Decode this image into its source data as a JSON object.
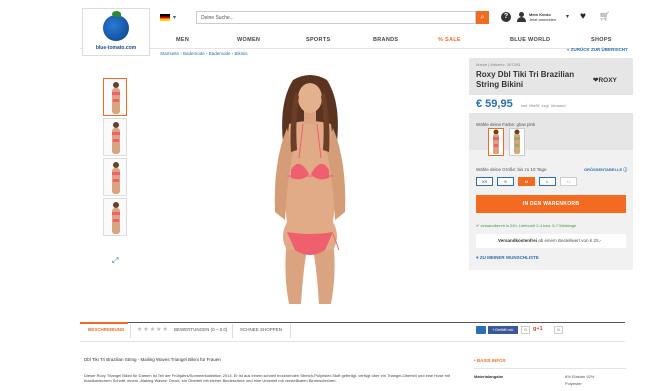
{
  "header": {
    "logo_text": "blue-tomato.com",
    "search_placeholder": "Deine Suche...",
    "search_icon": "search-icon",
    "user_line1": "Mein Konto",
    "user_line2": "Jetzt anmelden"
  },
  "nav": {
    "items": [
      "MEN",
      "WOMEN",
      "SPORTS",
      "BRANDS",
      "% SALE",
      "BLUE WORLD",
      "SHOPS"
    ],
    "sale_color": "#f26b21"
  },
  "breadcrumb": "Startseite  ›  Bademode  ›  Bademode  ›  Bikinis",
  "back_link": "« ZURÜCK ZUR ÜBERSICHT",
  "product": {
    "art_no": "Marke  |  Artikelnr. 307393",
    "title": "Roxy Dbl Tiki Tri Brazilian String Bikini",
    "brand": "❤ROXY",
    "price": "€ 59,95",
    "price_note": "inkl. MwSt. zzgl. Versand",
    "color_label": "Wähle deine Farbe: glow pink",
    "size_label": "Wähle deine Größe: bis zu 10 Tage",
    "size_table": "GRÖSSENTABELLE ⓘ",
    "sizes": [
      "XS",
      "S",
      "M",
      "L",
      "XL"
    ],
    "selected_size": "M",
    "cart_label": "IN DEN WARENKORB",
    "delivery": "✔ versandbereit in 24h, Lieferzeit 2-4 bzw. 5-7 Werktage",
    "shipping_bold": "Versandkostenfrei",
    "shipping_rest": " ab einem Bestellwert von € 25,-",
    "wishlist": "♥ ZU MEINER WUNSCHLISTE",
    "accent": "#f26b21",
    "link_color": "#2a6fb5"
  },
  "tabs": {
    "description": "BESCHREIBUNG",
    "stars": "★★★★★",
    "reviews": "BEWERTUNGEN (0 – 0.0)",
    "similar": "SCHNEE SHOPPEN",
    "fb_label": "f Gefällt mir",
    "fb_count": "0",
    "g_label": "g+1",
    "g_count": "0"
  },
  "description": {
    "title": "Dbl Tiki Tri Brazilian String - Mailing Waves Triangel Bikini für Frauen",
    "text": "Dieser Roxy Triangel Bikini für Damen ist Teil der Frühjahrs/Sommerkollektion 2014. Er ist aus einem schnell trocknenden Stretch-Polyester-Stoff gefertigt, verfügt über ein Triangel-Oberteil und eine Hose mit brasilianischem Schnitt, einem „Making Waves“ Druck, ein Oberteil mit kleiner Bindeschnur und eine Unterteil mit verstellbaren Bindeschnüren."
  },
  "info": {
    "heading": "• BASIS INFOS",
    "key": "Materialangabe",
    "values": [
      "8% Elastan 92%",
      "Polyester"
    ]
  }
}
